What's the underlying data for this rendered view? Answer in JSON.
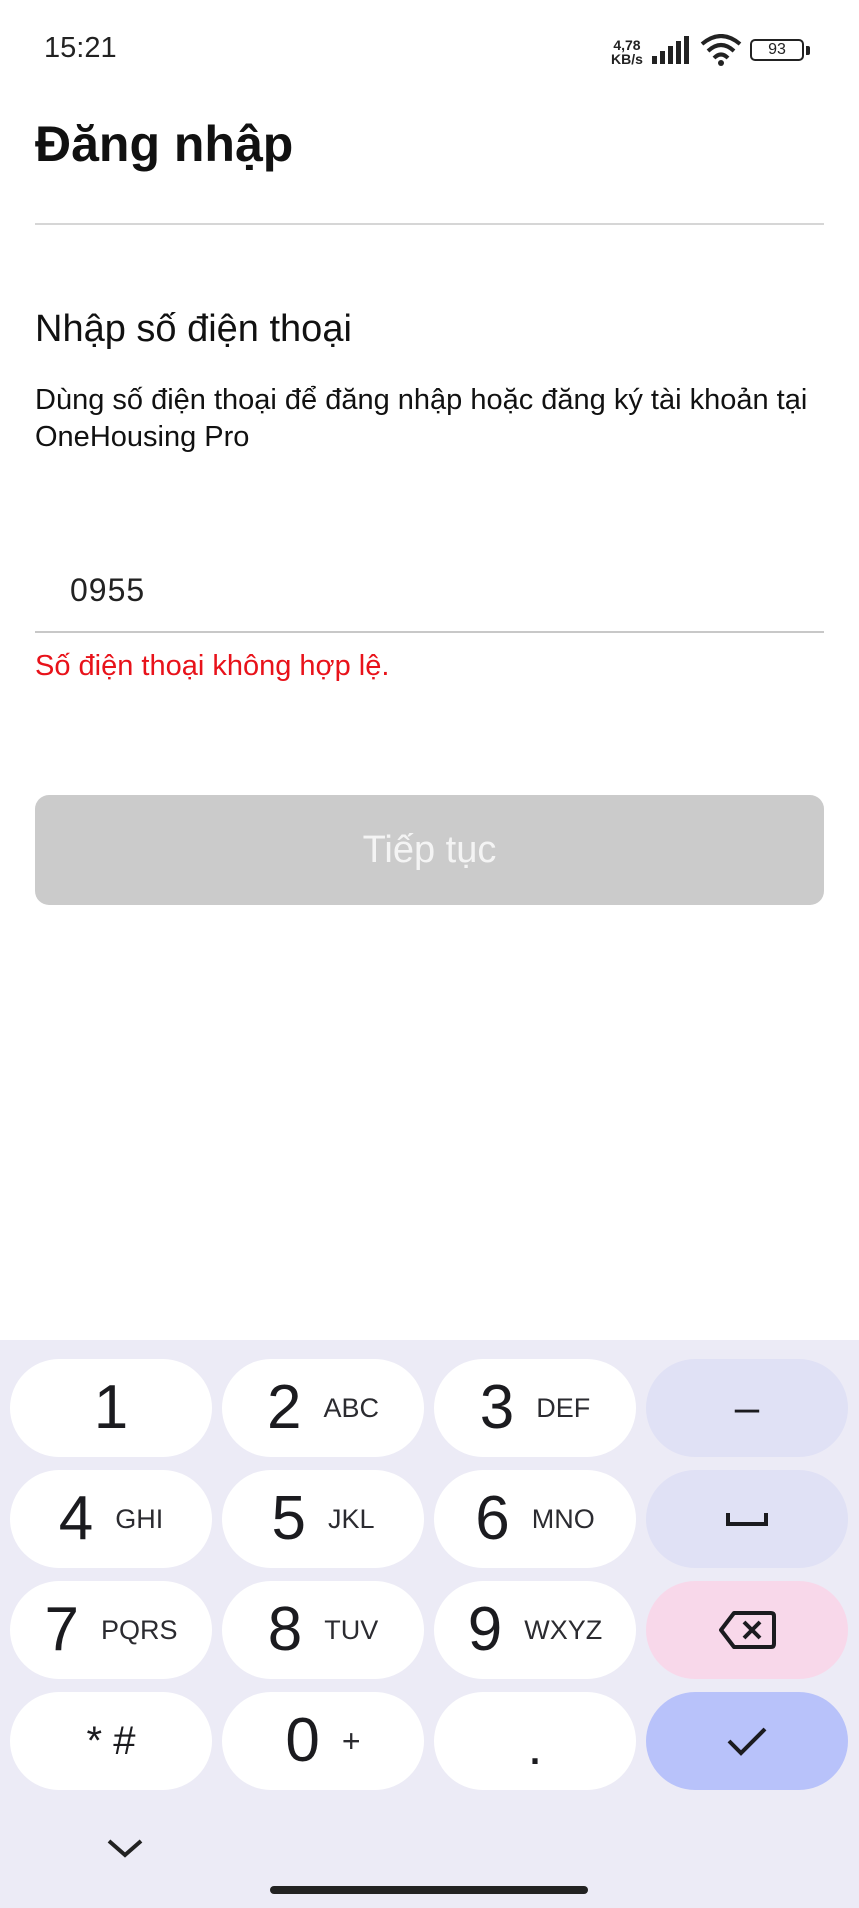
{
  "status_bar": {
    "time": "15:21",
    "net_speed_value": "4,78",
    "net_speed_unit": "KB/s",
    "battery": "93"
  },
  "header": {
    "title": "Đăng nhập"
  },
  "form": {
    "heading": "Nhập số điện thoại",
    "description": "Dùng số điện thoại để đăng nhập hoặc đăng ký tài khoản tại OneHousing Pro",
    "phone_value": "0955",
    "error": "Số điện thoại không hợp lệ.",
    "continue_label": "Tiếp tục"
  },
  "keyboard": {
    "keys": [
      {
        "digit": "1",
        "letters": ""
      },
      {
        "digit": "2",
        "letters": "ABC"
      },
      {
        "digit": "3",
        "letters": "DEF"
      },
      {
        "digit": "4",
        "letters": "GHI"
      },
      {
        "digit": "5",
        "letters": "JKL"
      },
      {
        "digit": "6",
        "letters": "MNO"
      },
      {
        "digit": "7",
        "letters": "PQRS"
      },
      {
        "digit": "8",
        "letters": "TUV"
      },
      {
        "digit": "9",
        "letters": "WXYZ"
      },
      {
        "digit": "0",
        "letters": "+"
      }
    ],
    "minus": "–",
    "star_hash": "* #",
    "dot": ".",
    "icons": [
      "space-icon",
      "backspace-icon",
      "checkmark-icon",
      "chevron-down-icon"
    ],
    "colors": {
      "background": "#ecebf6",
      "func_key": "#e0e1f5",
      "delete_key": "#f8d8ea",
      "ok_key": "#b8c2fa"
    }
  },
  "colors": {
    "error": "#e8121a",
    "button_disabled": "#cbcbcb"
  }
}
